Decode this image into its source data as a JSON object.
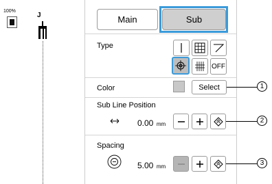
{
  "zoom_label": "100%",
  "presser_foot_letter": "J",
  "tabs": {
    "main": "Main",
    "sub": "Sub",
    "active": "sub"
  },
  "type": {
    "label": "Type",
    "options": [
      {
        "name": "single-line",
        "label": ""
      },
      {
        "name": "grid",
        "label": ""
      },
      {
        "name": "diagonal",
        "label": ""
      },
      {
        "name": "target",
        "label": "",
        "selected": true
      },
      {
        "name": "hash",
        "label": ""
      },
      {
        "name": "off",
        "label": "OFF"
      }
    ]
  },
  "color": {
    "label": "Color",
    "button": "Select",
    "swatch": "#c8c8c8"
  },
  "sub_line_position": {
    "label": "Sub Line Position",
    "value": "0.00",
    "unit": "mm"
  },
  "spacing": {
    "label": "Spacing",
    "value": "5.00",
    "unit": "mm"
  },
  "callouts": [
    "1",
    "2",
    "3"
  ],
  "accent": "#3b9ad9"
}
